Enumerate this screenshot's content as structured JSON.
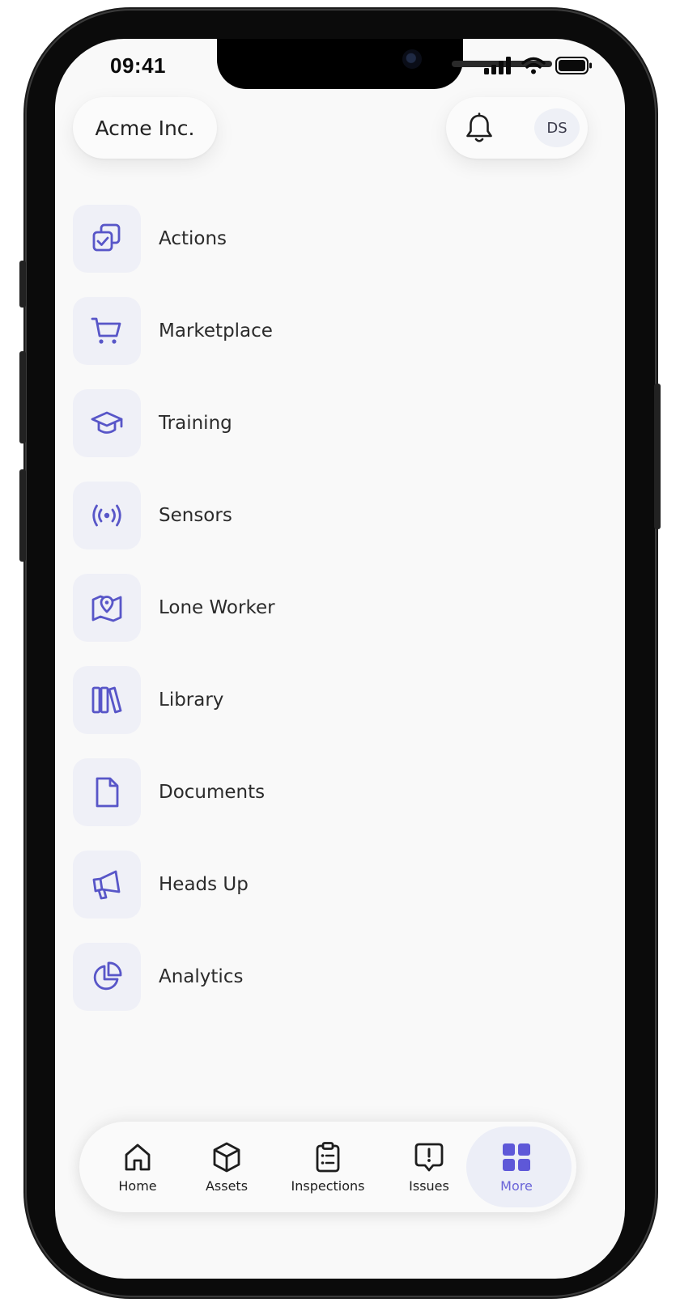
{
  "status_bar": {
    "time": "09:41"
  },
  "header": {
    "company": "Acme Inc.",
    "avatar_initials": "DS"
  },
  "menu": {
    "items": [
      {
        "label": "Actions",
        "icon": "check-squares-icon"
      },
      {
        "label": "Marketplace",
        "icon": "cart-icon"
      },
      {
        "label": "Training",
        "icon": "graduation-cap-icon"
      },
      {
        "label": "Sensors",
        "icon": "broadcast-icon"
      },
      {
        "label": "Lone Worker",
        "icon": "map-pin-icon"
      },
      {
        "label": "Library",
        "icon": "books-icon"
      },
      {
        "label": "Documents",
        "icon": "document-icon"
      },
      {
        "label": "Heads Up",
        "icon": "megaphone-icon"
      },
      {
        "label": "Analytics",
        "icon": "pie-chart-icon"
      }
    ]
  },
  "tabbar": {
    "tabs": [
      {
        "label": "Home",
        "icon": "home-icon"
      },
      {
        "label": "Assets",
        "icon": "cube-icon"
      },
      {
        "label": "Inspections",
        "icon": "clipboard-icon"
      },
      {
        "label": "Issues",
        "icon": "alert-bubble-icon"
      },
      {
        "label": "More",
        "icon": "grid-icon",
        "active": true
      }
    ]
  },
  "colors": {
    "accent": "#5856c8",
    "active_tab": "#6a64d8",
    "icon_tile_bg": "#eff0f7",
    "screen_bg": "#f9f9f9"
  }
}
